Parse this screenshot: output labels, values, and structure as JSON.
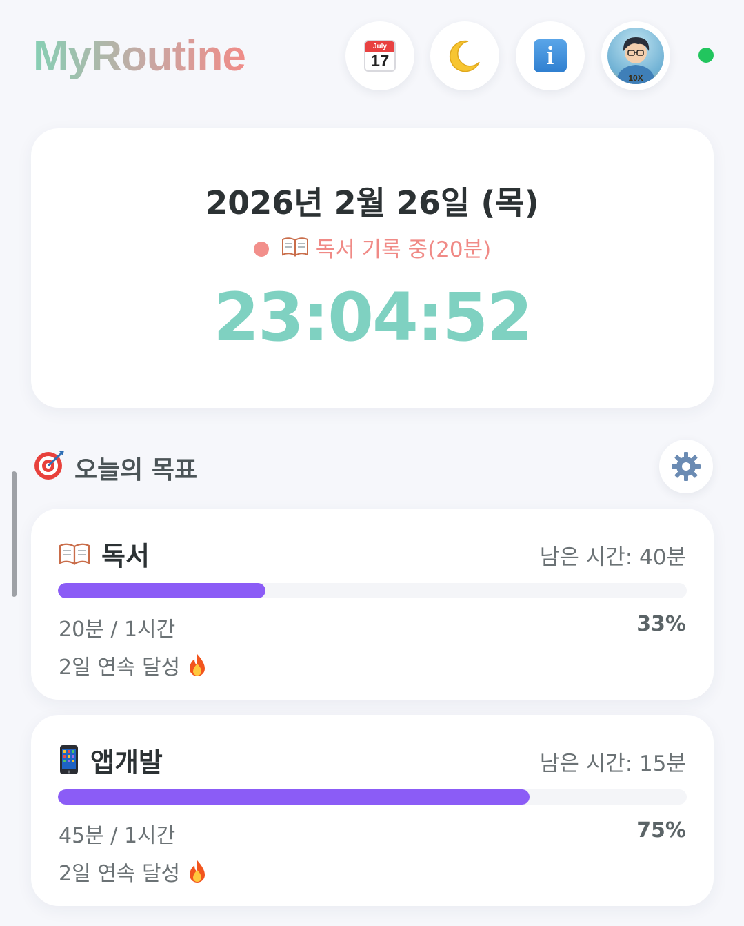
{
  "header": {
    "brand": "MyRoutine",
    "calendar_icon": {
      "month": "July",
      "day": "17"
    },
    "theme_icon": "crescent-moon-icon",
    "info_icon": "info-icon",
    "avatar_badge": "10X",
    "status_color": "#22c55e"
  },
  "clock": {
    "date": "2026년 2월 26일 (목)",
    "recording": "독서 기록 중(20분)",
    "time": "23:04:52"
  },
  "goals_section": {
    "title": "오늘의 목표",
    "settings_icon": "gear-icon",
    "items": [
      {
        "icon": "book-icon",
        "name": "독서",
        "remaining": "남은 시간: 40분",
        "progress_text": "20분 / 1시간",
        "percent_label": "33%",
        "fraction": 0.33,
        "streak": "2일 연속 달성",
        "streak_icon": "fire-icon"
      },
      {
        "icon": "phone-icon",
        "name": "앱개발",
        "remaining": "남은 시간: 15분",
        "progress_text": "45분 / 1시간",
        "percent_label": "75%",
        "fraction": 0.75,
        "streak": "2일 연속 달성",
        "streak_icon": "fire-icon"
      }
    ]
  },
  "colors": {
    "accent_purple": "#8b5cf6",
    "clock_teal": "#7fd1c1",
    "recording_coral": "#f08a86"
  }
}
